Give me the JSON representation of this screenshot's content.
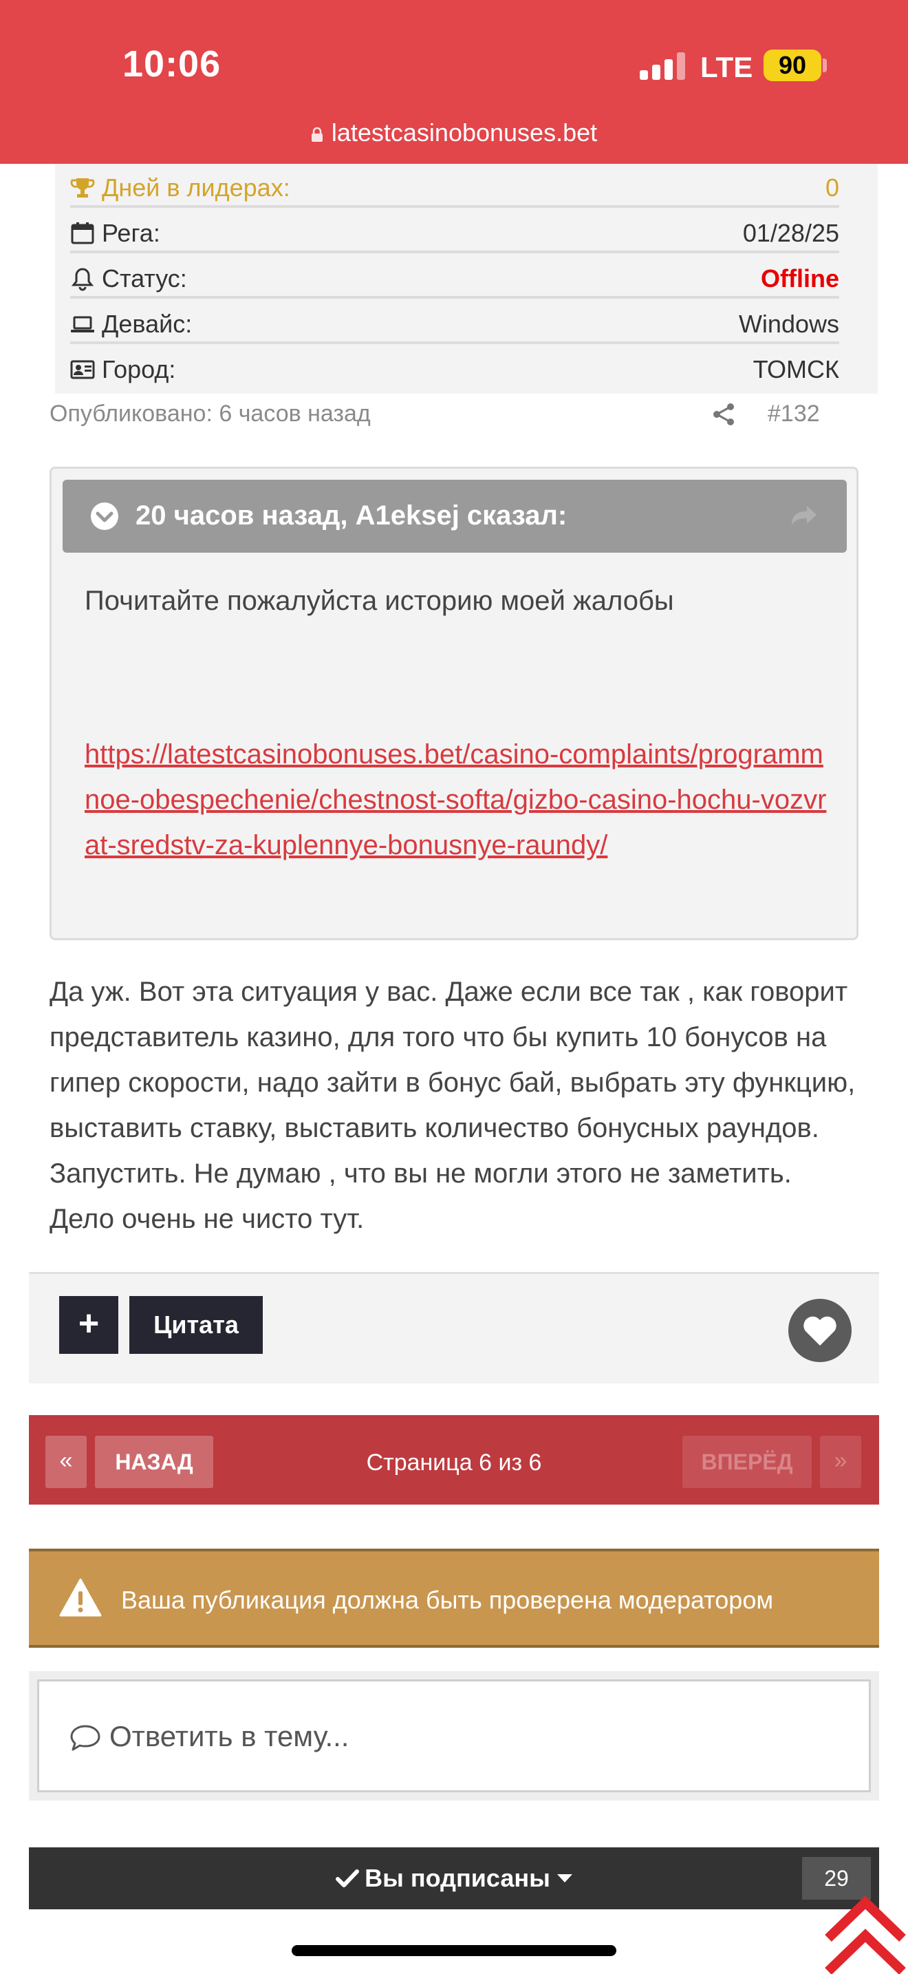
{
  "status_bar": {
    "time": "10:06",
    "network": "LTE",
    "battery": "90",
    "url": "latestcasinobonuses.bet"
  },
  "profile": {
    "rows": [
      {
        "label": "Дней в лидерах:",
        "value": "0",
        "icon": "trophy-icon"
      },
      {
        "label": "Рега:",
        "value": "01/28/25",
        "icon": "calendar-icon"
      },
      {
        "label": "Статус:",
        "value": "Offline",
        "icon": "bell-icon"
      },
      {
        "label": "Девайс:",
        "value": "Windows",
        "icon": "laptop-icon"
      },
      {
        "label": "Город:",
        "value": "ТОМСК",
        "icon": "id-card-icon"
      }
    ]
  },
  "post": {
    "published": "Опубликовано: 6 часов назад",
    "number": "#132",
    "quote": {
      "header": "20 часов назад, A1eksej сказал:",
      "text": "Почитайте пожалуйста историю моей жалобы",
      "link": "https://latestcasinobonuses.bet/casino-complaints/programmnoe-obespechenie/chestnost-softa/gizbo-casino-hochu-vozvrat-sredstv-za-kuplennye-bonusnye-raundy/"
    },
    "body": "Да уж. Вот эта ситуация у вас. Даже если все так , как говорит представитель казино, для того что бы купить 10 бонусов на гипер скорости, надо зайти в бонус бай, выбрать эту функцию, выставить ставку, выставить количество бонусных раундов. Запустить. Не думаю , что вы не могли этого не заметить. Дело очень не чисто тут.",
    "actions": {
      "plus": "+",
      "quote": "Цитата"
    }
  },
  "pagination": {
    "first": "«",
    "prev": "НАЗАД",
    "info": "Страница 6 из 6",
    "next": "ВПЕРЁД",
    "last": "»"
  },
  "warning": "Ваша публикация должна быть проверена модератором",
  "reply": {
    "placeholder": "Ответить в тему..."
  },
  "subscription": {
    "label": "Вы подписаны",
    "count": "29"
  },
  "colors": {
    "brand_red": "#e2454a",
    "pager_red": "#bd3a3f",
    "warning_gold": "#c9964f",
    "link_red": "#d83a3f",
    "dark_button": "#262633"
  }
}
